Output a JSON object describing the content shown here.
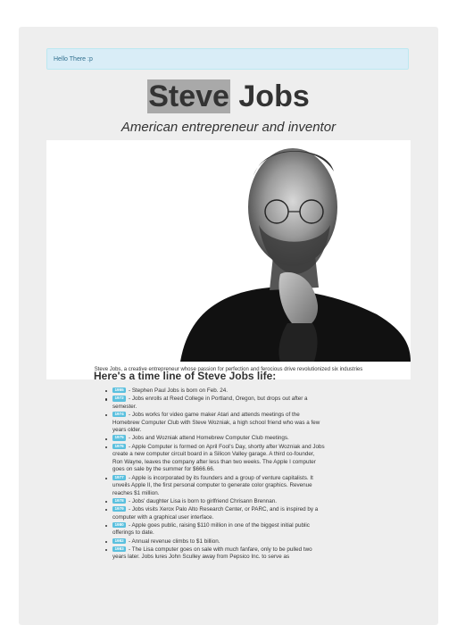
{
  "alert": {
    "text": "Hello There :p"
  },
  "header": {
    "title_highlight": "Steve",
    "title_rest": " Jobs",
    "subtitle": "American entrepreneur and inventor"
  },
  "photo": {
    "caption": "Steve Jobs, a creative entrepreneur whose passion for perfection and ferocious drive revolutionized six industries"
  },
  "timeline": {
    "title": "Here's a time line of Steve Jobs life:",
    "items": [
      {
        "year": "1955",
        "text": " - Stephen Paul Jobs is born on Feb. 24."
      },
      {
        "year": "1972",
        "text": " - Jobs enrolls at Reed College in Portland, Oregon, but drops out after a semester."
      },
      {
        "year": "1974",
        "text": " - Jobs works for video game maker Atari and attends meetings of the Homebrew Computer Club with Steve Wozniak, a high school friend who was a few years older."
      },
      {
        "year": "1975",
        "text": " - Jobs and Wozniak attend Homebrew Computer Club meetings."
      },
      {
        "year": "1976",
        "text": " - Apple Computer is formed on April Fool's Day, shortly after Wozniak and Jobs create a new computer circuit board in a Silicon Valley garage. A third co-founder, Ron Wayne, leaves the company after less than two weeks. The Apple I computer goes on sale by the summer for $666.66."
      },
      {
        "year": "1977",
        "text": " - Apple is incorporated by its founders and a group of venture capitalists. It unveils Apple II, the first personal computer to generate color graphics. Revenue reaches $1 million."
      },
      {
        "year": "1978",
        "text": " - Jobs' daughter Lisa is born to girlfriend Chrisann Brennan."
      },
      {
        "year": "1979",
        "text": " - Jobs visits Xerox Palo Alto Research Center, or PARC, and is inspired by a computer with a graphical user interface."
      },
      {
        "year": "1980",
        "text": " - Apple goes public, raising $110 million in one of the biggest initial public offerings to date."
      },
      {
        "year": "1982",
        "text": " - Annual revenue climbs to $1 billion."
      },
      {
        "year": "1983",
        "text": " - The Lisa computer goes on sale with much fanfare, only to be pulled two years later. Jobs lures John Sculley away from Pepsico Inc. to serve as"
      }
    ]
  },
  "colors": {
    "alert_bg": "#d9edf7",
    "label_bg": "#5bc0de",
    "card_bg": "#eeeeee"
  }
}
